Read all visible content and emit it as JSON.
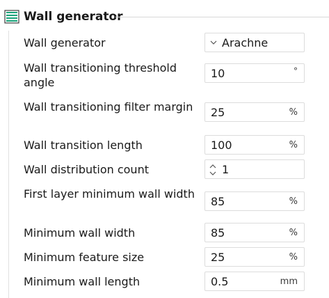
{
  "section": {
    "icon": "wall-layers-icon",
    "title": "Wall generator"
  },
  "rows": [
    {
      "label": "Wall generator",
      "value": "Arachne",
      "kind": "combo"
    },
    {
      "label": "Wall transitioning threshold angle",
      "value": "10",
      "unit": "°",
      "kind": "number"
    },
    {
      "label": "Wall transitioning filter margin",
      "value": "25",
      "unit": "%",
      "kind": "number"
    },
    {
      "label": "Wall transition length",
      "value": "100",
      "unit": "%",
      "kind": "number"
    },
    {
      "label": "Wall distribution count",
      "value": "1",
      "kind": "spin"
    },
    {
      "label": "First layer minimum wall width",
      "value": "85",
      "unit": "%",
      "kind": "number"
    },
    {
      "label": "Minimum wall width",
      "value": "85",
      "unit": "%",
      "kind": "number"
    },
    {
      "label": "Minimum feature size",
      "value": "25",
      "unit": "%",
      "kind": "number"
    },
    {
      "label": "Minimum wall length",
      "value": "0.5",
      "unit": "mm",
      "kind": "number"
    }
  ],
  "colors": {
    "icon_accent": "#1aa37a",
    "field_border": "#dcdcdc"
  }
}
